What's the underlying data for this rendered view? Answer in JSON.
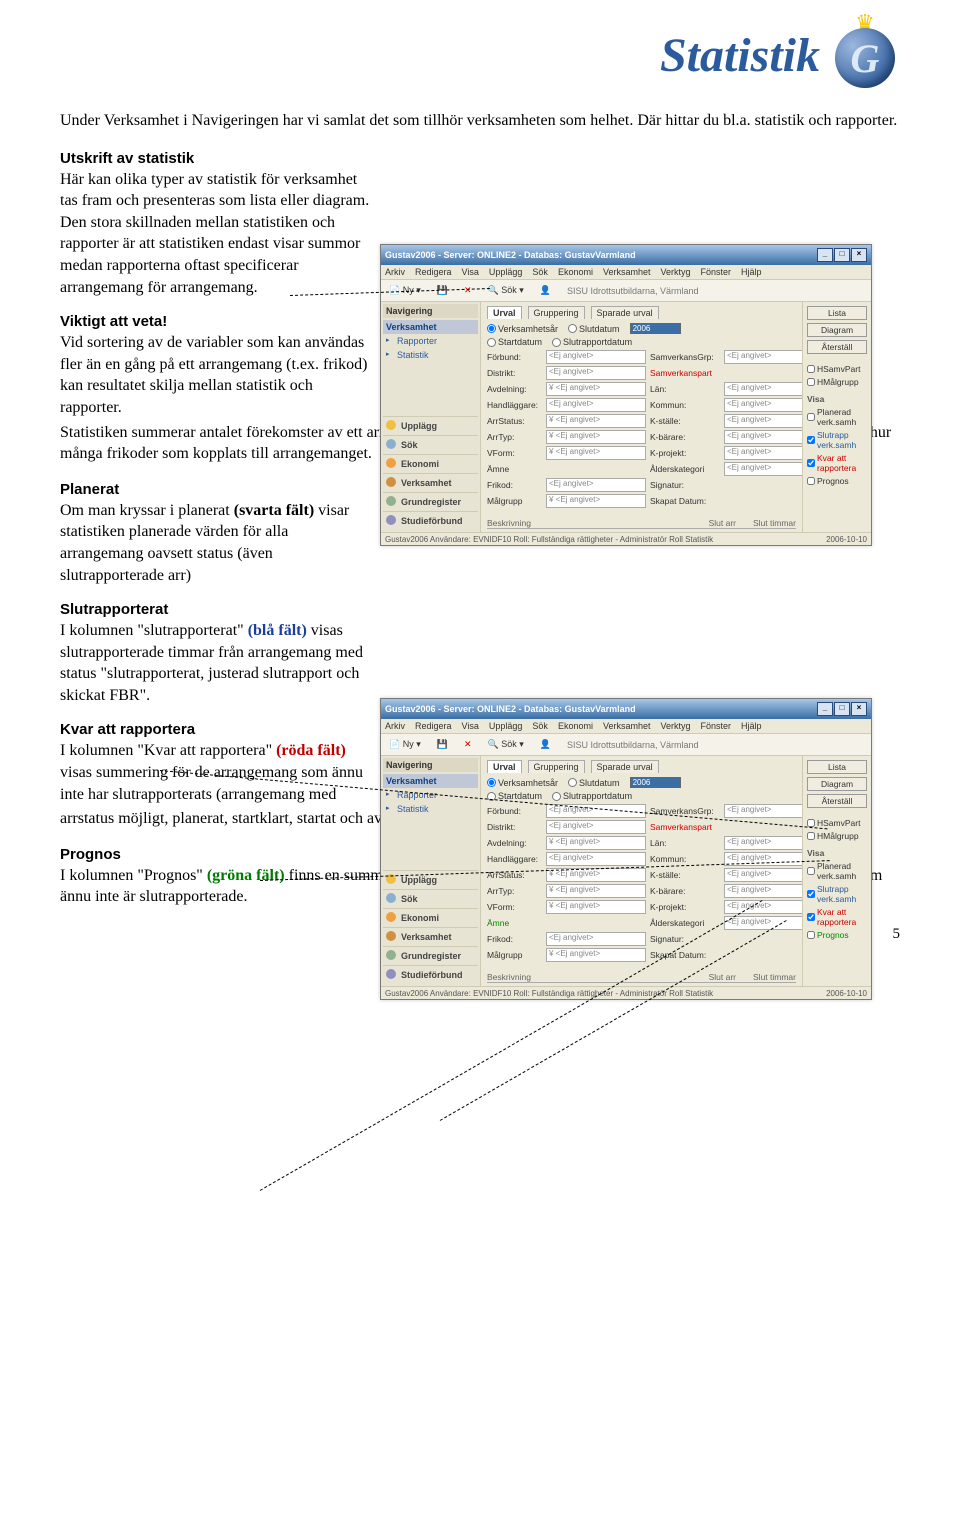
{
  "header": {
    "title": "Statistik",
    "logo_letter": "G"
  },
  "intro": "Under Verksamhet i Navigeringen har vi samlat det som tillhör verksamheten som helhet. Där hittar du bl.a. statistik och rapporter.",
  "sections": {
    "utskrift": {
      "title": "Utskrift av statistik",
      "body": "Här kan olika typer av statistik för verksamhet tas fram och presenteras som lista eller diagram. Den stora skillnaden mellan statistiken och rapporter är att statistiken endast visar summor medan rapporterna oftast specificerar arrangemang för arrangemang."
    },
    "viktigt": {
      "title": "Viktigt att veta!",
      "body_a": "Vid sortering av de variabler som kan användas fler än en gång på ett arrangemang (t.ex. frikod) kan resultatet skilja mellan statistik och rapporter. ",
      "body_b": "Statistiken summerar antalet förekomster av ett arrangemang i listan medan rapporterna summerar unika arrangemang oavsett hur många frikoder som kopplats till arrangemanget."
    },
    "planerat": {
      "title": "Planerat",
      "pre": "Om man kryssar i planerat ",
      "strong": "(svarta fält)",
      "post": " visar statistiken planerade värden för alla arrangemang oavsett status (även slutrapporterade arr)"
    },
    "slutrapporterat": {
      "title": "Slutrapporterat",
      "pre": "I kolumnen \"slutrapporterat\" ",
      "strong": "(blå fält)",
      "post": " visas slutrapporterade timmar från arrangemang med status \"slutrapporterat, justerad slutrapport och skickat FBR\"."
    },
    "kvar": {
      "title": "Kvar att rapportera",
      "pre": "I kolumnen \"Kvar att rapportera\" ",
      "strong": "(röda fält)",
      "post_a": " visas summering för de arrangemang som ännu inte har slutrapporterats (arrangemang med ",
      "post_b": "arrstatus möjligt, planerat, startklart, startat och avslutat)"
    },
    "prognos": {
      "title": "Prognos",
      "pre": "I kolumnen \"Prognos\" ",
      "strong": "(gröna fält)",
      "post": " finns en summering på slutrapporterade timmar + planerade timmar för de arrangemang som ännu inte är slutrapporterade."
    }
  },
  "page_number": "5",
  "screenshot": {
    "title": "Gustav2006 - Server: ONLINE2 - Databas: GustavVarmland",
    "menu": [
      "Arkiv",
      "Redigera",
      "Visa",
      "Upplägg",
      "Sök",
      "Ekonomi",
      "Verksamhet",
      "Verktyg",
      "Fönster",
      "Hjälp"
    ],
    "toolbar": {
      "new": "Ny",
      "sok": "Sök",
      "huvudman": "SISU Idrottsutbildarna, Värmland"
    },
    "nav": {
      "title": "Navigering",
      "verksamhet": "Verksamhet",
      "items": [
        "Rapporter",
        "Statistik"
      ],
      "bottom": [
        "Upplägg",
        "Sök",
        "Ekonomi",
        "Verksamhet",
        "Grundregister",
        "Studieförbund"
      ]
    },
    "tabs": [
      "Urval",
      "Gruppering",
      "Sparade urval"
    ],
    "filter": {
      "r1": "Verksamhetsår",
      "r2": "Startdatum",
      "r3": "Slutdatum",
      "r4": "Slutrapportdatum",
      "year": "2006"
    },
    "fields": [
      {
        "l": "Förbund:",
        "v": "<Ej angivet>",
        "l2": "SamverkansGrp:",
        "v2": "<Ej angivet>"
      },
      {
        "l": "Distrikt:",
        "v": "<Ej angivet>",
        "l2": "Samverkanspart",
        "v2": ""
      },
      {
        "l": "Avdelning:",
        "v": "¥  <Ej angivet>",
        "l2": "Län:",
        "v2": "<Ej angivet>"
      },
      {
        "l": "Handläggare:",
        "v": "<Ej angivet>",
        "l2": "Kommun:",
        "v2": "<Ej angivet>"
      },
      {
        "l": "ArrStatus:",
        "v": "¥  <Ej angivet>",
        "l2": "K-ställe:",
        "v2": "<Ej angivet>"
      },
      {
        "l": "ArrTyp:",
        "v": "¥  <Ej angivet>",
        "l2": "K-bärare:",
        "v2": "<Ej angivet>"
      },
      {
        "l": "VForm:",
        "v": "¥  <Ej angivet>",
        "l2": "K-projekt:",
        "v2": "<Ej angivet>"
      },
      {
        "l": "Ämne",
        "v": "",
        "l2": "Ålderskategori",
        "v2": "<Ej angivet>"
      },
      {
        "l": "Frikod:",
        "v": "<Ej angivet>",
        "l2": "Signatur:",
        "v2": ""
      },
      {
        "l": "Målgrupp",
        "v": "¥  <Ej angivet>",
        "l2": "Skapat Datum:",
        "v2": ""
      }
    ],
    "right": {
      "lista": "Lista",
      "diagram": "Diagram",
      "aterstall": "Återställ",
      "visa": "Visa",
      "chk1": "HSamvPart",
      "chk2": "HMålgrupp",
      "chk3": "Planerad verk.samh",
      "chk4": "Slutrapp verk.samh",
      "chk5": "Kvar att rapportera",
      "chk6": "Prognos"
    },
    "results": {
      "h1": "Beskrivning",
      "h2": "Slut arr",
      "h3": "Slut timmar"
    },
    "status": {
      "left": "Gustav2006   Användare: EVNIDF10  Roll: Fullständiga rättigheter - Administratör Roll   Statistik",
      "right": "2006-10-10"
    }
  }
}
